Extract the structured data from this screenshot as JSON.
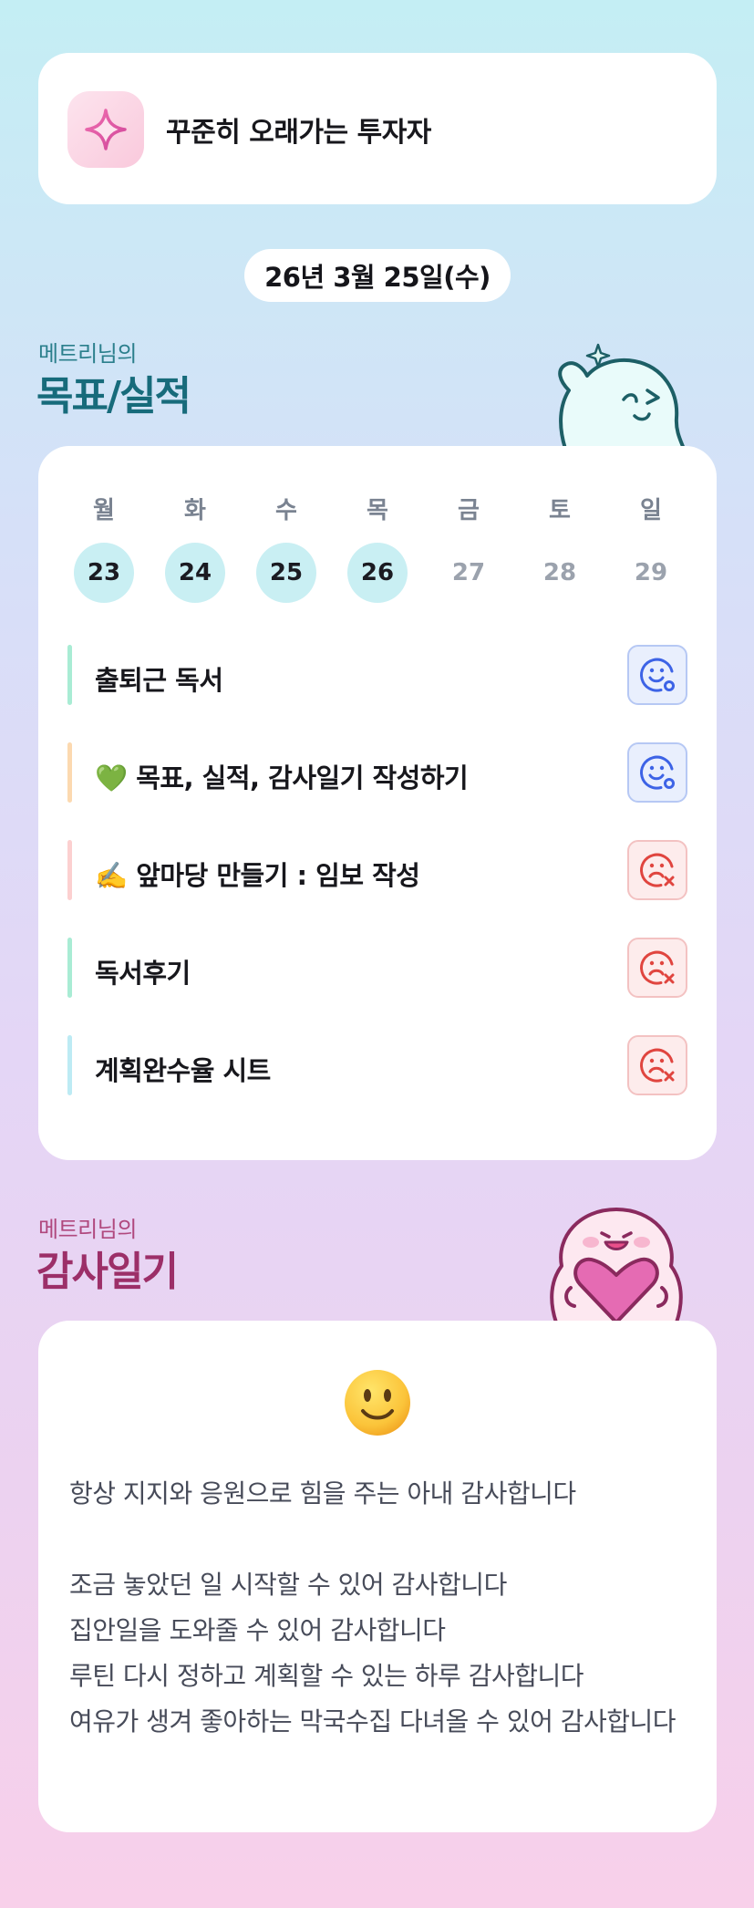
{
  "profile": {
    "title": "꾸준히 오래가는 투자자",
    "icon": "sparkle-icon"
  },
  "date_label": "26년 3월 25일(수)",
  "goals_section": {
    "subtitle": "메트리님의",
    "title": "목표/실적"
  },
  "week": {
    "weekdays": [
      "월",
      "화",
      "수",
      "목",
      "금",
      "토",
      "일"
    ],
    "dates": [
      "23",
      "24",
      "25",
      "26",
      "27",
      "28",
      "29"
    ],
    "active_count": 4
  },
  "goals": [
    {
      "text": "출퇴근 독서",
      "status": "done",
      "bar_color": "#a9ecd4"
    },
    {
      "text": "💚 목표, 실적, 감사일기 작성하기",
      "status": "done",
      "bar_color": "#fcd9b0"
    },
    {
      "text": "✍️ 앞마당 만들기 : 임보 작성",
      "status": "missed",
      "bar_color": "#fcd0d0"
    },
    {
      "text": "독서후기",
      "status": "missed",
      "bar_color": "#a9ecd4"
    },
    {
      "text": "계획완수율 시트",
      "status": "missed",
      "bar_color": "#bdebf4"
    }
  ],
  "diary_section": {
    "subtitle": "메트리님의",
    "title": "감사일기"
  },
  "diary": {
    "emoji": "slightly-smiling-face",
    "text": "항상 지지와 응원으로 힘을 주는 아내 감사합니다\n\n조금 놓았던 일 시작할 수 있어 감사합니다\n집안일을 도와줄 수 있어 감사합니다\n루틴 다시 정하고 계획할 수 있는 하루 감사합니다\n여유가 생겨 좋아하는 막국수집 다녀올 수 있어 감사합니다"
  },
  "colors": {
    "done": "#3d63e6",
    "missed": "#e0453f",
    "goals_title": "#176b7b",
    "diary_title": "#9c2f68"
  }
}
